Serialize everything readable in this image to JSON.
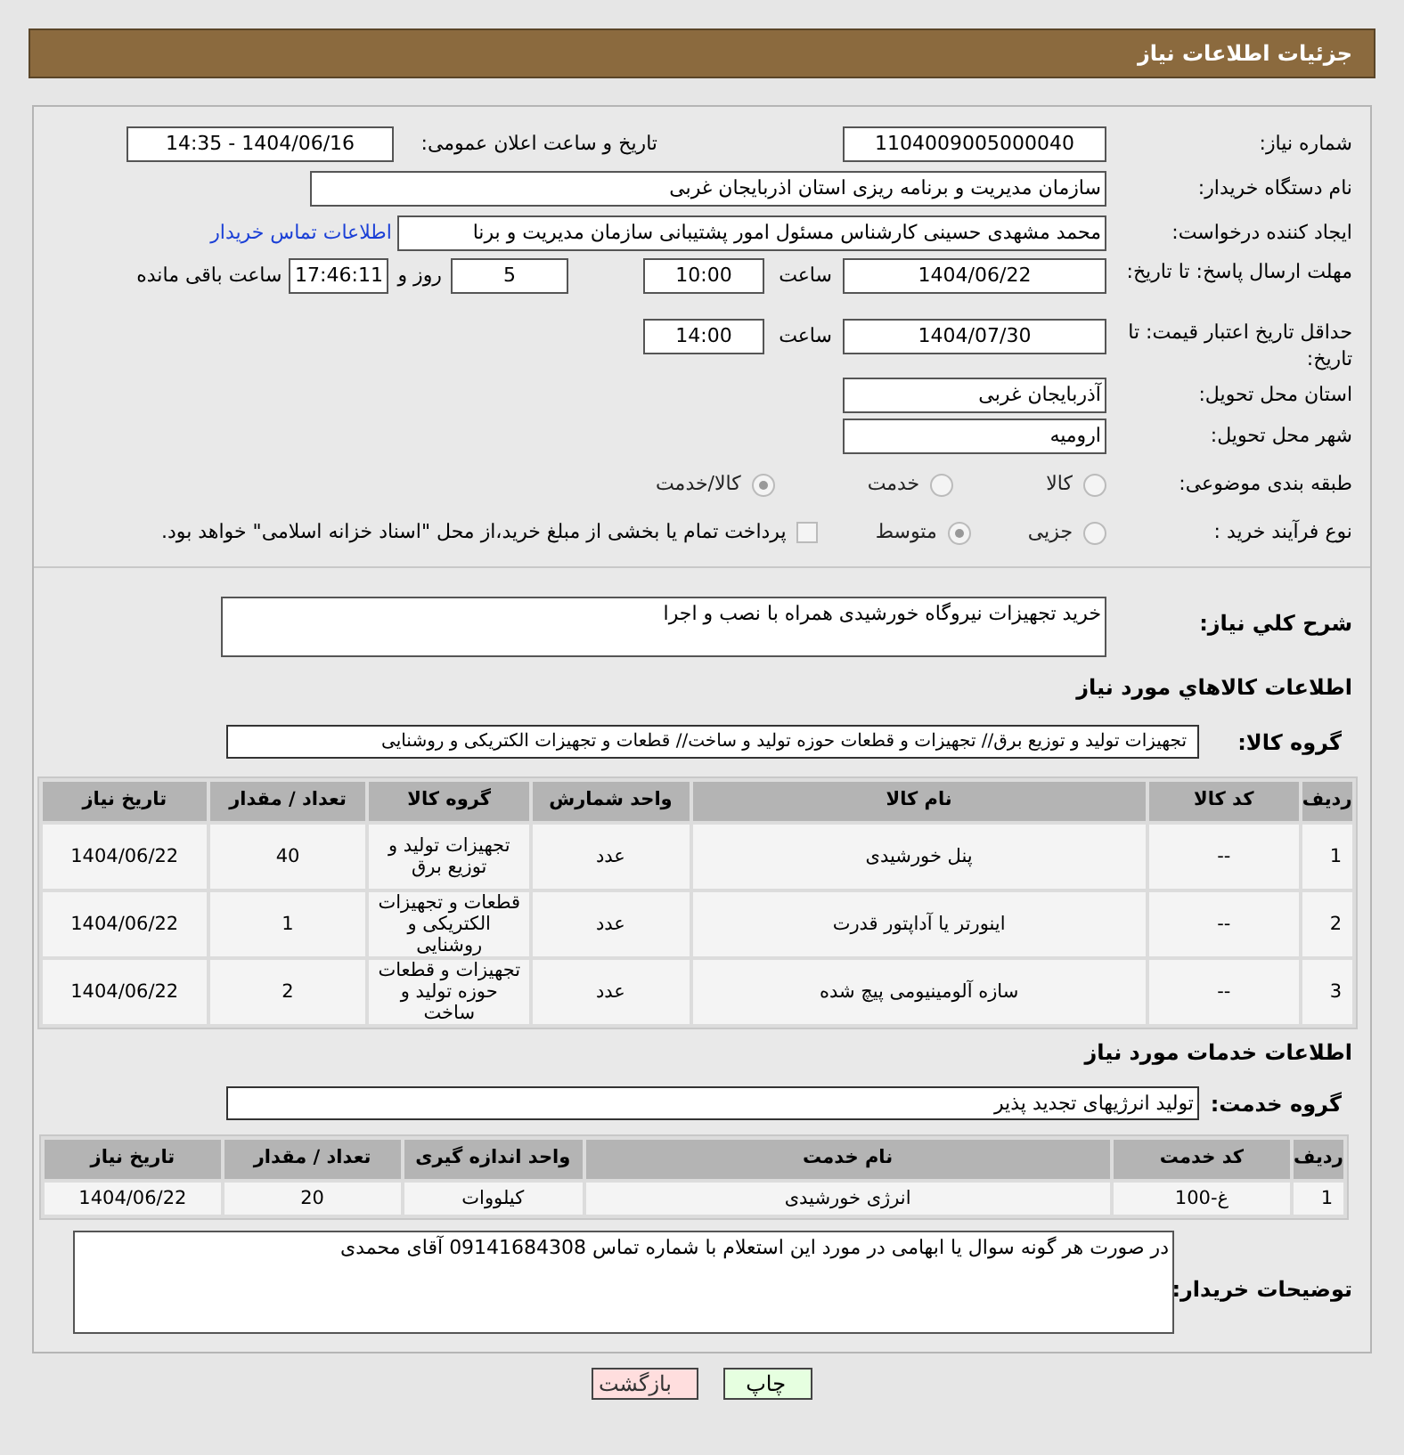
{
  "header": {
    "title": "جزئیات اطلاعات نیاز"
  },
  "need_number": {
    "label": "شماره نیاز:",
    "value": "1104009005000040"
  },
  "announce": {
    "label": "تاریخ و ساعت اعلان عمومی:",
    "value": "1404/06/16 - 14:35"
  },
  "buyer_org": {
    "label": "نام دستگاه خریدار:",
    "value": "سازمان مدیریت و برنامه ریزی استان اذربایجان غربی"
  },
  "requester": {
    "label": "ایجاد کننده درخواست:",
    "value": "محمد مشهدی حسینی کارشناس مسئول امور پشتیبانی سازمان مدیریت و برنا",
    "link": "اطلاعات تماس خریدار"
  },
  "reply_deadline": {
    "label": "مهلت ارسال پاسخ: تا تاریخ:",
    "date": "1404/06/22",
    "time_label": "ساعت",
    "time": "10:00",
    "days": "5",
    "days_label": "روز و",
    "remaining": "17:46:11",
    "remaining_label": "ساعت باقی مانده"
  },
  "price_validity": {
    "label": "حداقل تاریخ اعتبار قیمت: تا تاریخ:",
    "date": "1404/07/30",
    "time_label": "ساعت",
    "time": "14:00"
  },
  "province": {
    "label": "استان محل تحویل:",
    "value": "آذربایجان غربی"
  },
  "city": {
    "label": "شهر محل تحویل:",
    "value": "ارومیه"
  },
  "category": {
    "label": "طبقه بندی موضوعی:",
    "options": [
      {
        "label": "کالا",
        "selected": false
      },
      {
        "label": "خدمت",
        "selected": false
      },
      {
        "label": "کالا/خدمت",
        "selected": true
      }
    ]
  },
  "process": {
    "label": "نوع فرآیند خرید :",
    "options": [
      {
        "label": "جزیی",
        "selected": false
      },
      {
        "label": "متوسط",
        "selected": true
      }
    ],
    "treasury": {
      "checked": false,
      "text": "پرداخت تمام یا بخشی از مبلغ خرید،از محل \"اسناد خزانه اسلامی\" خواهد بود."
    }
  },
  "description": {
    "label": "شرح کلي نياز:",
    "value": "خرید تجهیزات نیروگاه خورشیدی همراه با نصب و اجرا"
  },
  "goods": {
    "title": "اطلاعات كالاهاي مورد نياز",
    "group_label": "گروه کالا:",
    "group": "تجهیزات تولید و توزیع برق// تجهیزات و قطعات حوزه تولید و ساخت// قطعات و تجهیزات الکتریکی و روشنایی",
    "columns": [
      "ردیف",
      "کد کالا",
      "نام کالا",
      "واحد شمارش",
      "گروه کالا",
      "تعداد / مقدار",
      "تاریخ نیاز"
    ],
    "rows": [
      [
        "1",
        "--",
        "پنل خورشیدی",
        "عدد",
        "تجهیزات تولید و توزیع برق",
        "40",
        "1404/06/22"
      ],
      [
        "2",
        "--",
        "اینورتر یا آداپتور قدرت",
        "عدد",
        "قطعات و تجهیزات الکتریکی و روشنایی",
        "1",
        "1404/06/22"
      ],
      [
        "3",
        "--",
        "سازه آلومینیومی پیچ شده",
        "عدد",
        "تجهیزات و قطعات حوزه تولید و ساخت",
        "2",
        "1404/06/22"
      ]
    ]
  },
  "services": {
    "title": "اطلاعات خدمات مورد نیاز",
    "group_label": "گروه خدمت:",
    "group": "تولید انرژیهای تجدید پذیر",
    "columns": [
      "ردیف",
      "کد خدمت",
      "نام خدمت",
      "واحد اندازه گیری",
      "تعداد / مقدار",
      "تاریخ نیاز"
    ],
    "rows": [
      [
        "1",
        "غ-100",
        "انرژی خورشیدی",
        "کیلووات",
        "20",
        "1404/06/22"
      ]
    ]
  },
  "buyer_notes": {
    "label": "توضیحات خریدار:",
    "value": "در صورت هر گونه سوال یا ابهامی در مورد این استعلام با شماره تماس 09141684308 آقای محمدی"
  },
  "buttons": [
    {
      "label": "چاپ",
      "kind": "print"
    },
    {
      "label": "بازگشت",
      "kind": "back"
    }
  ]
}
